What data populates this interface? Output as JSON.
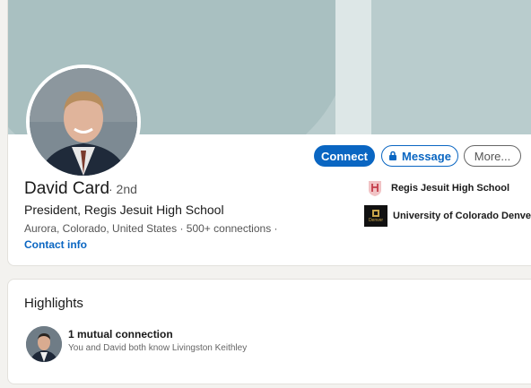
{
  "profile": {
    "name": "David Card",
    "degree": "· 2nd",
    "headline": "President, Regis Jesuit High School",
    "location": "Aurora, Colorado, United States",
    "connections": "500+ connections",
    "separator": "·",
    "contact_info": "Contact info"
  },
  "actions": {
    "connect_label": "Connect",
    "message_label": "Message",
    "more_label": "More..."
  },
  "education": [
    {
      "name": "Regis Jesuit High School",
      "logo": "regis-shield-icon"
    },
    {
      "name": "University of Colorado Denver",
      "logo": "cu-denver-logo",
      "logo_text": "Denver"
    }
  ],
  "highlights": {
    "title": "Highlights",
    "mutual_title": "1 mutual connection",
    "mutual_subtitle": "You and David both know Livingston Keithley"
  },
  "colors": {
    "accent": "#0a66c2",
    "banner": "#b9cccd",
    "page_bg": "#f3f2ef"
  }
}
